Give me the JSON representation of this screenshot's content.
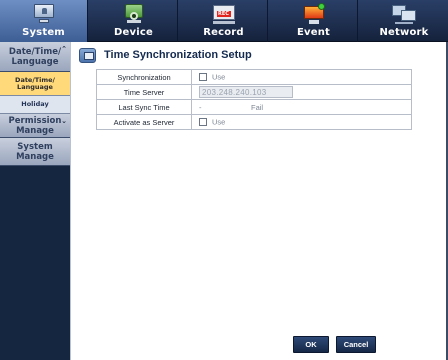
{
  "nav": {
    "tabs": [
      {
        "label": "System",
        "icon": "monitor-icon",
        "active": true
      },
      {
        "label": "Device",
        "icon": "camera-device-icon",
        "active": false
      },
      {
        "label": "Record",
        "icon": "record-icon",
        "active": false
      },
      {
        "label": "Event",
        "icon": "event-alarm-icon",
        "active": false
      },
      {
        "label": "Network",
        "icon": "network-icon",
        "active": false
      }
    ],
    "record_badge": "REC"
  },
  "sidebar": {
    "groups": [
      {
        "label": "Date/Time/ Language",
        "items": [
          "Date/Time/ Language",
          "Holiday"
        ],
        "selected": "Date/Time/ Language"
      },
      {
        "label": "Permission Manage"
      },
      {
        "label": "System Manage"
      }
    ]
  },
  "panel": {
    "title": "Time Synchronization Setup",
    "rows": [
      {
        "label": "Synchronization",
        "option": "Use",
        "checked": false
      },
      {
        "label": "Time Server",
        "value": "203.248.240.103"
      },
      {
        "label": "Last Sync Time",
        "value": "-",
        "status": "Fail"
      },
      {
        "label": "Activate as Server",
        "option": "Use",
        "checked": false
      }
    ]
  },
  "buttons": {
    "ok": "OK",
    "cancel": "Cancel"
  },
  "colors": {
    "active_tab": "#5877ab",
    "selected_sidebar": "#ffd97a",
    "header_bg": "#1d2d4d",
    "button_bg": "#1f355c"
  }
}
